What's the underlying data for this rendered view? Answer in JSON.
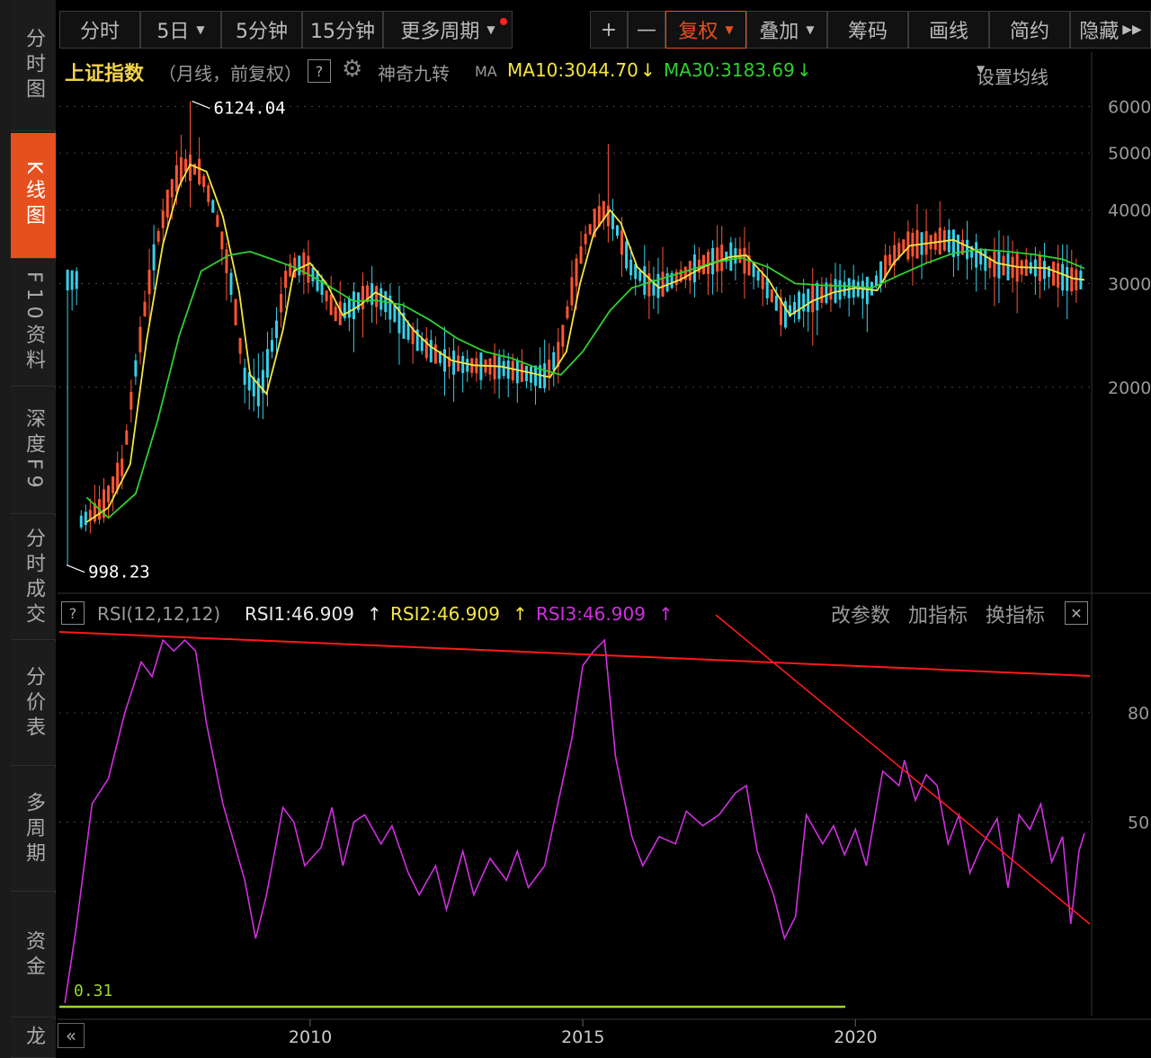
{
  "sidebar": {
    "tabs": [
      {
        "label": "分时图",
        "active": false
      },
      {
        "label": "K线图",
        "active": true
      },
      {
        "label": "F10资料",
        "active": false
      },
      {
        "label": "深度F9",
        "active": false
      },
      {
        "label": "分时成交",
        "active": false
      },
      {
        "label": "分价表",
        "active": false
      },
      {
        "label": "多周期",
        "active": false
      },
      {
        "label": "资金",
        "active": false
      },
      {
        "label": "龙",
        "active": false
      }
    ]
  },
  "toolbar": {
    "period_buttons": [
      "分时",
      "5日",
      "5分钟",
      "15分钟",
      "更多周期"
    ],
    "zoom_in": "+",
    "zoom_out": "—",
    "adjust_button": "复权",
    "overlay_button": "叠加",
    "chips_button": "筹码",
    "draw_button": "画线",
    "simple_button": "简约",
    "hide_button": "隐藏"
  },
  "info": {
    "index_name": "上证指数",
    "mode": "（月线，前复权）",
    "help": "?",
    "indicator": "神奇九转",
    "ma_label": "MA",
    "ma10": "MA10:3044.70",
    "ma30": "MA30:3183.69",
    "settings": "设置均线"
  },
  "rsi_panel": {
    "help": "?",
    "name": "RSI(12,12,12)",
    "rsi1": "RSI1:46.909",
    "rsi2": "RSI2:46.909",
    "rsi3": "RSI3:46.909",
    "edit_params": "改参数",
    "add_indicator": "加指标",
    "switch_indicator": "换指标",
    "close": "✕"
  },
  "nav": {
    "back": "«"
  },
  "colors": {
    "ma10": "#f5e642",
    "ma30": "#2fd02f",
    "rsi": "#d030e0",
    "trendline": "#ff1a1a",
    "up_candle": "#ff5533",
    "down_candle": "#35d0e8",
    "zero_line": "#9bd62e",
    "accent": "#e6501e"
  },
  "chart_data": [
    {
      "type": "line",
      "title": "上证指数",
      "series": [
        {
          "name": "MA10",
          "points": [
            [
              2005.9,
              1180
            ],
            [
              2006.3,
              1250
            ],
            [
              2006.7,
              1480
            ],
            [
              2007.0,
              2400
            ],
            [
              2007.3,
              3500
            ],
            [
              2007.6,
              4400
            ],
            [
              2007.8,
              4780
            ],
            [
              2008.1,
              4650
            ],
            [
              2008.4,
              3900
            ],
            [
              2008.7,
              2900
            ],
            [
              2008.9,
              2100
            ],
            [
              2009.2,
              1950
            ],
            [
              2009.5,
              2500
            ],
            [
              2009.7,
              3150
            ],
            [
              2010.0,
              3250
            ],
            [
              2010.3,
              3000
            ],
            [
              2010.6,
              2650
            ],
            [
              2010.9,
              2750
            ],
            [
              2011.2,
              2900
            ],
            [
              2011.5,
              2800
            ],
            [
              2011.9,
              2500
            ],
            [
              2012.2,
              2350
            ],
            [
              2012.6,
              2220
            ],
            [
              2013.0,
              2180
            ],
            [
              2013.5,
              2170
            ],
            [
              2014.0,
              2120
            ],
            [
              2014.4,
              2080
            ],
            [
              2014.7,
              2300
            ],
            [
              2014.95,
              3000
            ],
            [
              2015.2,
              3650
            ],
            [
              2015.5,
              4000
            ],
            [
              2015.7,
              3800
            ],
            [
              2016.0,
              3200
            ],
            [
              2016.4,
              2950
            ],
            [
              2016.8,
              3050
            ],
            [
              2017.2,
              3200
            ],
            [
              2017.7,
              3330
            ],
            [
              2018.0,
              3350
            ],
            [
              2018.4,
              3050
            ],
            [
              2018.8,
              2650
            ],
            [
              2019.2,
              2800
            ],
            [
              2019.6,
              2900
            ],
            [
              2020.0,
              2950
            ],
            [
              2020.4,
              2920
            ],
            [
              2020.7,
              3250
            ],
            [
              2021.0,
              3480
            ],
            [
              2021.4,
              3520
            ],
            [
              2021.8,
              3560
            ],
            [
              2022.2,
              3420
            ],
            [
              2022.6,
              3250
            ],
            [
              2023.0,
              3200
            ],
            [
              2023.5,
              3190
            ],
            [
              2024.0,
              3060
            ],
            [
              2024.2,
              3044.7
            ]
          ]
        },
        {
          "name": "MA30",
          "points": [
            [
              2005.9,
              1300
            ],
            [
              2006.3,
              1200
            ],
            [
              2006.8,
              1320
            ],
            [
              2007.2,
              1750
            ],
            [
              2007.6,
              2450
            ],
            [
              2008.0,
              3150
            ],
            [
              2008.5,
              3350
            ],
            [
              2008.9,
              3400
            ],
            [
              2009.3,
              3300
            ],
            [
              2009.7,
              3200
            ],
            [
              2010.0,
              3100
            ],
            [
              2010.4,
              2950
            ],
            [
              2010.8,
              2800
            ],
            [
              2011.2,
              2810
            ],
            [
              2011.7,
              2760
            ],
            [
              2012.2,
              2600
            ],
            [
              2012.7,
              2420
            ],
            [
              2013.2,
              2300
            ],
            [
              2013.7,
              2240
            ],
            [
              2014.2,
              2150
            ],
            [
              2014.6,
              2100
            ],
            [
              2015.0,
              2300
            ],
            [
              2015.5,
              2700
            ],
            [
              2015.9,
              2950
            ],
            [
              2016.4,
              3050
            ],
            [
              2016.9,
              3150
            ],
            [
              2017.4,
              3260
            ],
            [
              2017.9,
              3320
            ],
            [
              2018.4,
              3200
            ],
            [
              2018.9,
              3000
            ],
            [
              2019.4,
              2980
            ],
            [
              2019.9,
              2970
            ],
            [
              2020.3,
              2950
            ],
            [
              2020.8,
              3100
            ],
            [
              2021.3,
              3250
            ],
            [
              2021.8,
              3380
            ],
            [
              2022.3,
              3430
            ],
            [
              2022.8,
              3400
            ],
            [
              2023.3,
              3360
            ],
            [
              2023.8,
              3300
            ],
            [
              2024.2,
              3183.69
            ]
          ]
        }
      ],
      "annotations": [
        {
          "label": "6124.04",
          "x": 2007.8,
          "y": 6124
        },
        {
          "label": "998.23",
          "x": 2005.5,
          "y": 998
        }
      ],
      "y_axis_labels": [
        "6000",
        "5000",
        "4000",
        "3000",
        "2000"
      ],
      "ylim": [
        900,
        6400
      ],
      "xlim": [
        2005.4,
        2024.3
      ],
      "grid": true
    },
    {
      "type": "line",
      "title": "RSI(12,12,12)",
      "series": [
        {
          "name": "RSI",
          "points": [
            [
              2005.5,
              0.31
            ],
            [
              2005.7,
              20
            ],
            [
              2006.0,
              55
            ],
            [
              2006.3,
              62
            ],
            [
              2006.6,
              80
            ],
            [
              2006.9,
              94
            ],
            [
              2007.1,
              90
            ],
            [
              2007.3,
              100
            ],
            [
              2007.5,
              97
            ],
            [
              2007.7,
              100
            ],
            [
              2007.9,
              97
            ],
            [
              2008.1,
              77
            ],
            [
              2008.4,
              55
            ],
            [
              2008.8,
              34
            ],
            [
              2009.0,
              18
            ],
            [
              2009.2,
              30
            ],
            [
              2009.5,
              54
            ],
            [
              2009.7,
              50
            ],
            [
              2009.9,
              38
            ],
            [
              2010.2,
              43
            ],
            [
              2010.4,
              54
            ],
            [
              2010.6,
              38
            ],
            [
              2010.8,
              50
            ],
            [
              2011.0,
              52
            ],
            [
              2011.3,
              44
            ],
            [
              2011.5,
              49
            ],
            [
              2011.8,
              36
            ],
            [
              2012.0,
              30
            ],
            [
              2012.3,
              38
            ],
            [
              2012.5,
              26
            ],
            [
              2012.8,
              42
            ],
            [
              2013.0,
              30
            ],
            [
              2013.3,
              40
            ],
            [
              2013.6,
              34
            ],
            [
              2013.8,
              42
            ],
            [
              2014.0,
              32
            ],
            [
              2014.3,
              38
            ],
            [
              2014.5,
              52
            ],
            [
              2014.8,
              73
            ],
            [
              2015.0,
              93
            ],
            [
              2015.2,
              97
            ],
            [
              2015.4,
              100
            ],
            [
              2015.6,
              68
            ],
            [
              2015.9,
              46
            ],
            [
              2016.1,
              38
            ],
            [
              2016.4,
              46
            ],
            [
              2016.7,
              44
            ],
            [
              2016.9,
              53
            ],
            [
              2017.2,
              49
            ],
            [
              2017.5,
              52
            ],
            [
              2017.8,
              58
            ],
            [
              2018.0,
              60
            ],
            [
              2018.2,
              42
            ],
            [
              2018.5,
              30
            ],
            [
              2018.7,
              18
            ],
            [
              2018.9,
              24
            ],
            [
              2019.1,
              52
            ],
            [
              2019.4,
              44
            ],
            [
              2019.6,
              49
            ],
            [
              2019.8,
              41
            ],
            [
              2020.0,
              48
            ],
            [
              2020.2,
              38
            ],
            [
              2020.5,
              64
            ],
            [
              2020.8,
              60
            ],
            [
              2020.9,
              67
            ],
            [
              2021.1,
              56
            ],
            [
              2021.3,
              63
            ],
            [
              2021.5,
              60
            ],
            [
              2021.7,
              44
            ],
            [
              2021.9,
              52
            ],
            [
              2022.1,
              36
            ],
            [
              2022.3,
              43
            ],
            [
              2022.6,
              51
            ],
            [
              2022.8,
              32
            ],
            [
              2023.0,
              52
            ],
            [
              2023.2,
              48
            ],
            [
              2023.4,
              55
            ],
            [
              2023.6,
              39
            ],
            [
              2023.8,
              46
            ],
            [
              2023.95,
              22
            ],
            [
              2024.1,
              42
            ],
            [
              2024.2,
              46.909
            ]
          ]
        }
      ],
      "y_axis_labels": [
        "80",
        "50"
      ],
      "ylim": [
        -2,
        103
      ],
      "xlim": [
        2005.4,
        2024.3
      ],
      "x_tick_labels": [
        "2010",
        "2015",
        "2020"
      ],
      "x_ticks": [
        2010,
        2015,
        2020
      ],
      "green_label": "0.31",
      "grid": true
    }
  ]
}
